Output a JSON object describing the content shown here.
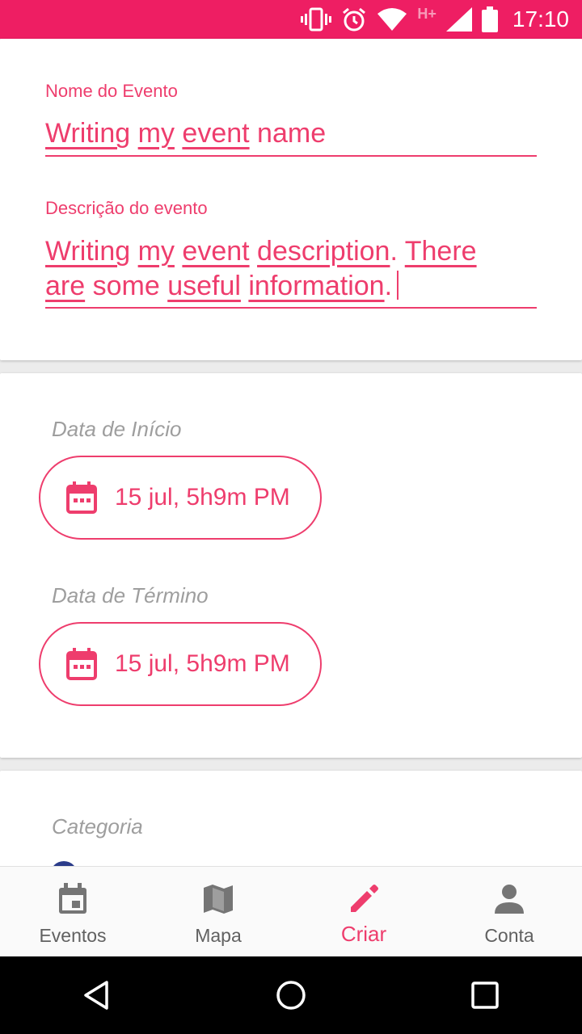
{
  "status_bar": {
    "time": "17:10",
    "network": "H+",
    "background": "#ee1e63",
    "icons": [
      "vibrate-icon",
      "alarm-icon",
      "wifi-icon",
      "signal-icon",
      "battery-icon"
    ]
  },
  "event_form": {
    "name_label": "Nome do Evento",
    "name_words": [
      "Writing",
      "my",
      "event",
      "name"
    ],
    "description_label": "Descrição do evento",
    "description_line1": [
      "Writing",
      "my",
      "event",
      "description",
      ". ",
      "There"
    ],
    "description_line2": [
      "are",
      "some",
      "useful",
      "information",
      "."
    ]
  },
  "dates": {
    "start_label": "Data de Início",
    "start_value": "15 jul, 5h9m PM",
    "end_label": "Data de Término",
    "end_value": "15 jul, 5h9m PM"
  },
  "category": {
    "label": "Categoria"
  },
  "bottom_nav": {
    "items": [
      {
        "label": "Eventos",
        "icon": "calendar-icon"
      },
      {
        "label": "Mapa",
        "icon": "map-icon"
      },
      {
        "label": "Criar",
        "icon": "pencil-icon"
      },
      {
        "label": "Conta",
        "icon": "person-icon"
      }
    ],
    "active_index": 2
  },
  "colors": {
    "accent": "#ee3d6d",
    "status_bar": "#ee1e63",
    "inactive": "#616161"
  }
}
